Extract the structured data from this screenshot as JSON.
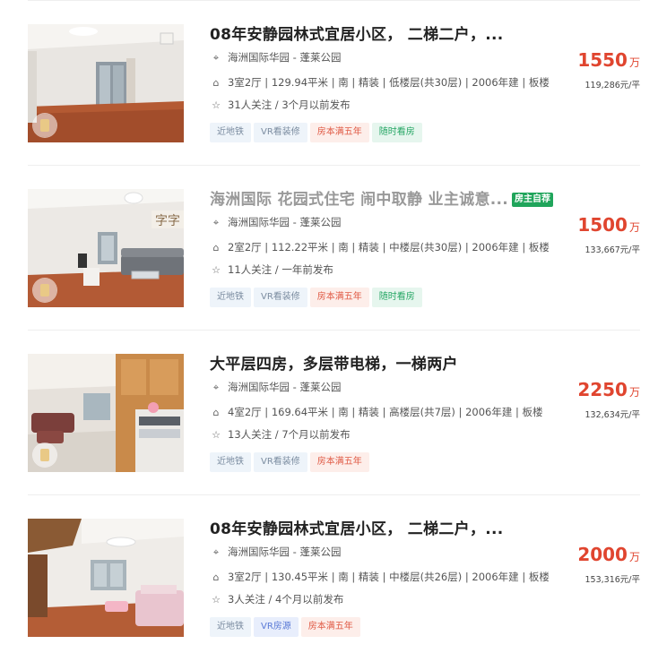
{
  "listings": [
    {
      "title": "08年安静园林式宜居小区， 二梯二户，...",
      "title_dim": false,
      "owner_tag": "",
      "location": "海洲国际华园 - 蓬莱公园",
      "desc": "3室2厅 | 129.94平米 | 南 | 精装 | 低楼层(共30层) | 2006年建 | 板楼",
      "follow": "31人关注 / 3个月以前发布",
      "tags": [
        {
          "label": "近地铁",
          "style": "blue"
        },
        {
          "label": "VR看装修",
          "style": "blue"
        },
        {
          "label": "房本满五年",
          "style": "red"
        },
        {
          "label": "随时看房",
          "style": "green"
        }
      ],
      "price": "1550",
      "price_unit": "万",
      "unit_price": "119,286元/平"
    },
    {
      "title": "海洲国际 花园式住宅 闹中取静 业主诚意...",
      "title_dim": true,
      "owner_tag": "房主自荐",
      "location": "海洲国际华园 - 蓬莱公园",
      "desc": "2室2厅 | 112.22平米 | 南 | 精装 | 中楼层(共30层) | 2006年建 | 板楼",
      "follow": "11人关注 / 一年前发布",
      "tags": [
        {
          "label": "近地铁",
          "style": "blue"
        },
        {
          "label": "VR看装修",
          "style": "blue"
        },
        {
          "label": "房本满五年",
          "style": "red"
        },
        {
          "label": "随时看房",
          "style": "green"
        }
      ],
      "price": "1500",
      "price_unit": "万",
      "unit_price": "133,667元/平"
    },
    {
      "title": "大平层四房，多层带电梯，一梯两户",
      "title_dim": false,
      "owner_tag": "",
      "location": "海洲国际华园 - 蓬莱公园",
      "desc": "4室2厅 | 169.64平米 | 南 | 精装 | 高楼层(共7层) | 2006年建 | 板楼",
      "follow": "13人关注 / 7个月以前发布",
      "tags": [
        {
          "label": "近地铁",
          "style": "blue"
        },
        {
          "label": "VR看装修",
          "style": "blue"
        },
        {
          "label": "房本满五年",
          "style": "red"
        }
      ],
      "price": "2250",
      "price_unit": "万",
      "unit_price": "132,634元/平"
    },
    {
      "title": "08年安静园林式宜居小区， 二梯二户，...",
      "title_dim": false,
      "owner_tag": "",
      "location": "海洲国际华园 - 蓬莱公园",
      "desc": "3室2厅 | 130.45平米 | 南 | 精装 | 中楼层(共26层) | 2006年建 | 板楼",
      "follow": "3人关注 / 4个月以前发布",
      "tags": [
        {
          "label": "近地铁",
          "style": "blue"
        },
        {
          "label": "VR房源",
          "style": "blue2"
        },
        {
          "label": "房本满五年",
          "style": "red"
        }
      ],
      "price": "2000",
      "price_unit": "万",
      "unit_price": "153,316元/平"
    }
  ],
  "icons": {
    "location": "map-pin-icon",
    "house": "house-icon",
    "follow": "star-icon",
    "vr": "vr-badge-icon"
  },
  "colors": {
    "price": "#e0452f",
    "owner_tag_bg": "#20a55b"
  }
}
